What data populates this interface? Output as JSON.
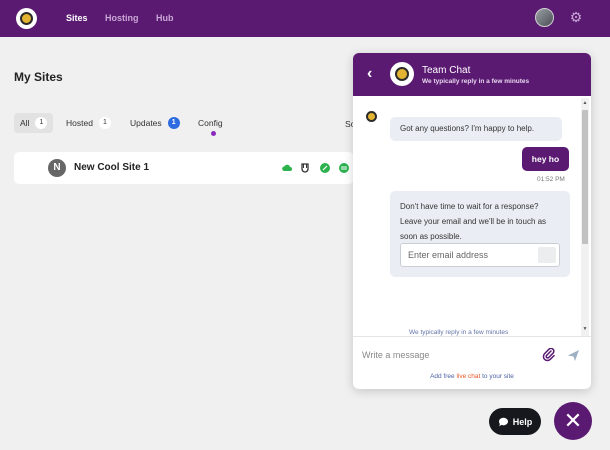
{
  "nav": {
    "items": [
      {
        "label": "Sites",
        "active": true
      },
      {
        "label": "Hosting",
        "active": false
      },
      {
        "label": "Hub",
        "active": false
      }
    ],
    "icons": {
      "logo": "bee-logo-icon",
      "avatar": "user-avatar",
      "settings": "gear-icon"
    }
  },
  "main": {
    "title": "My Sites",
    "tabs": [
      {
        "label": "All",
        "count": "1",
        "active": true
      },
      {
        "label": "Hosted",
        "count": "1",
        "active": false
      },
      {
        "label": "Updates",
        "count": "1",
        "active": false
      },
      {
        "label": "Config",
        "count": "",
        "active": false
      }
    ],
    "sort_label_partial": "So",
    "site": {
      "initial": "N",
      "name": "New Cool Site 1",
      "status_icons": [
        "cloud-icon",
        "shield-icon",
        "leaf-icon",
        "database-icon"
      ]
    }
  },
  "chat": {
    "title": "Team Chat",
    "subtitle": "We typically reply in a few minutes",
    "messages": [
      {
        "from": "bot",
        "text": "Got any questions? I'm happy to help."
      },
      {
        "from": "user",
        "text": "hey ho",
        "time": "01:52 PM"
      },
      {
        "from": "bot",
        "text": "Don't have time to wait for a response? Leave your email and we'll be in touch as soon as possible."
      }
    ],
    "email_placeholder": "Enter email address",
    "reply_note": "We typically reply in a few minutes",
    "composer_placeholder": "Write a message",
    "powered": {
      "prefix": "Add free ",
      "highlight": "live chat",
      "suffix": " to your site"
    }
  },
  "help_label": "Help",
  "colors": {
    "brand": "#5b1a72",
    "accent_blue": "#2d6be0",
    "success": "#2bb24c"
  }
}
